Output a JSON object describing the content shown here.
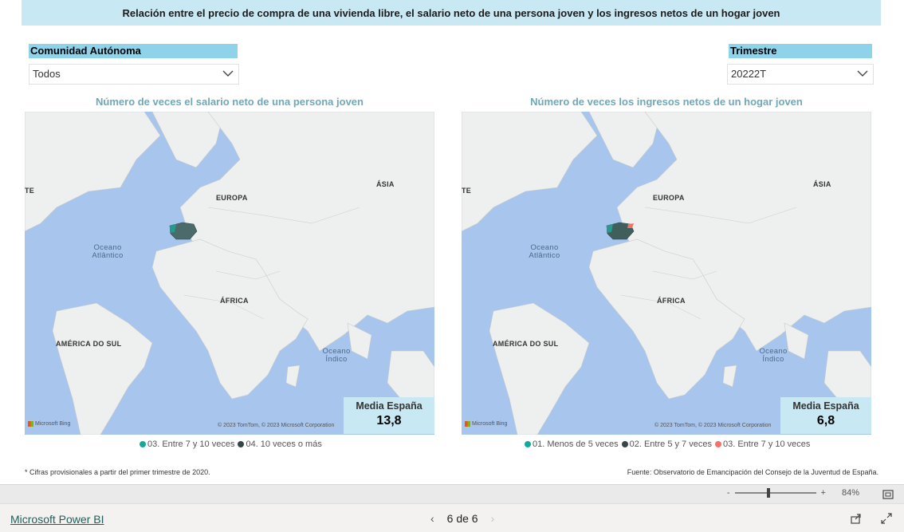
{
  "banner": {
    "title": "Relación entre el precio de compra de una vivienda libre, el salario neto de una persona joven y los ingresos netos de un hogar joven"
  },
  "slicers": {
    "comunidad": {
      "label": "Comunidad Autónoma",
      "value": "Todos"
    },
    "trimestre": {
      "label": "Trimestre",
      "value": "20222T"
    }
  },
  "maps": [
    {
      "title": "Número de veces el salario neto de una persona joven",
      "card_label": "Media España",
      "card_value": "13,8",
      "legend": [
        {
          "label": "03. Entre 7 y 10 veces",
          "color": "#15a99d"
        },
        {
          "label": "04. 10 veces o más",
          "color": "#374649"
        }
      ]
    },
    {
      "title": "Número de veces los ingresos netos de un hogar joven",
      "card_label": "Media España",
      "card_value": "6,8",
      "legend": [
        {
          "label": "01. Menos de 5 veces",
          "color": "#15a99d"
        },
        {
          "label": "02. Entre 5 y 7 veces",
          "color": "#374649"
        },
        {
          "label": "03. Entre 7 y 10 veces",
          "color": "#f2716b"
        }
      ]
    }
  ],
  "map_labels": {
    "europa": "EUROPA",
    "asia": "ÁSIA",
    "africa": "ÁFRICA",
    "america_sul": "AMÉRICA DO SUL",
    "oceano_atlantico_1": "Oceano",
    "oceano_atlantico_2": "Atlântico",
    "oceano_indico_1": "Oceano",
    "oceano_indico_2": "Índico",
    "edge": "TE",
    "bing": "Microsoft Bing",
    "copyright": "© 2023 TomTom, © 2023 Microsoft Corporation"
  },
  "footnote_left": "* Cifras provisionales a partir del primer trimestre de 2020.",
  "footnote_right": "Fuente: Observatorio de Emancipación del Consejo de la Juventud de España.",
  "zoom": {
    "minus": "-",
    "plus": "+",
    "value": "84%"
  },
  "bottom": {
    "brand": "Microsoft Power BI",
    "page": "6 de 6"
  },
  "colors": {
    "banner": "#c8e9f3",
    "slicer_header": "#8fd3ea",
    "ocean": "#a8c5ed",
    "land": "#eef0ef",
    "title": "#6ea8b9"
  }
}
